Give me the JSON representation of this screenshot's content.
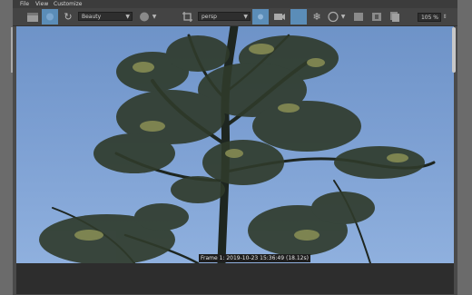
{
  "menu": {
    "file": "File",
    "view": "View",
    "customize": "Customize"
  },
  "toolbar": {
    "render_pass": "Beauty",
    "camera": "persp",
    "zoom": "105 %"
  },
  "status": {
    "frame_info": "Frame  1:  2019-10-23  15:36:49  (18.12s)"
  },
  "colors": {
    "accent": "#5b8db8",
    "sky_top": "#6e93c8",
    "sky_bottom": "#8fb0de"
  }
}
